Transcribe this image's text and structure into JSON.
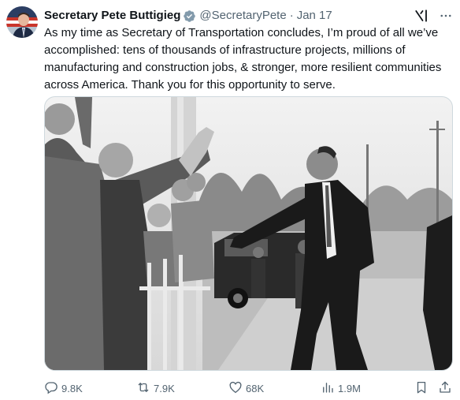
{
  "author": {
    "name": "Secretary Pete Buttigieg",
    "handle": "@SecretaryPete",
    "separator": "·",
    "date": "Jan 17"
  },
  "post": {
    "text": "As my time as Secretary of Transportation concludes, I’m proud of all we’ve accomplished: tens of thousands of infrastructure projects, millions of manufacturing and construction jobs, & stronger, more resilient communities across America. Thank you for this opportunity to serve."
  },
  "metrics": {
    "replies": "9.8K",
    "reposts": "7.9K",
    "likes": "68K",
    "views": "1.9M"
  },
  "colors": {
    "verified_badge": "#829aab",
    "text_primary": "#0f1419",
    "text_secondary": "#536471"
  },
  "icons": [
    "verified-icon",
    "grok-icon",
    "more-icon",
    "reply-icon",
    "repost-icon",
    "like-icon",
    "views-icon",
    "bookmark-icon",
    "share-icon"
  ]
}
